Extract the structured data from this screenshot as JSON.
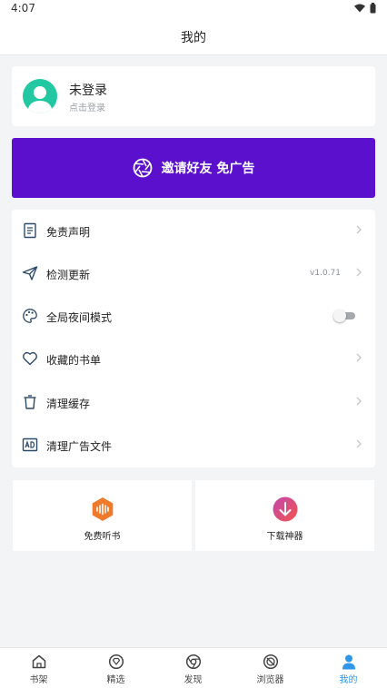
{
  "status_bar": {
    "time": "4:07"
  },
  "header": {
    "title": "我的"
  },
  "profile": {
    "name": "未登录",
    "subtitle": "点击登录"
  },
  "invite": {
    "label": "邀请好友 免广告"
  },
  "menu": {
    "disclaimer": "免责声明",
    "check_update": "检测更新",
    "version": "v1.0.71",
    "night_mode": "全局夜间模式",
    "night_mode_on": false,
    "favorites": "收藏的书单",
    "clear_cache": "清理缓存",
    "clear_ads": "清理广告文件"
  },
  "tiles": {
    "audiobook": "免费听书",
    "downloader": "下载神器"
  },
  "bottom_nav": {
    "bookshelf": "书架",
    "featured": "精选",
    "discover": "发现",
    "browser": "浏览器",
    "mine": "我的"
  },
  "colors": {
    "accent": "#2f96e8",
    "invite_banner": "#5a10cc",
    "avatar": "#21c8a2",
    "audiobook_icon": "#f07a2c",
    "downloader_icon": "#e8457a"
  }
}
